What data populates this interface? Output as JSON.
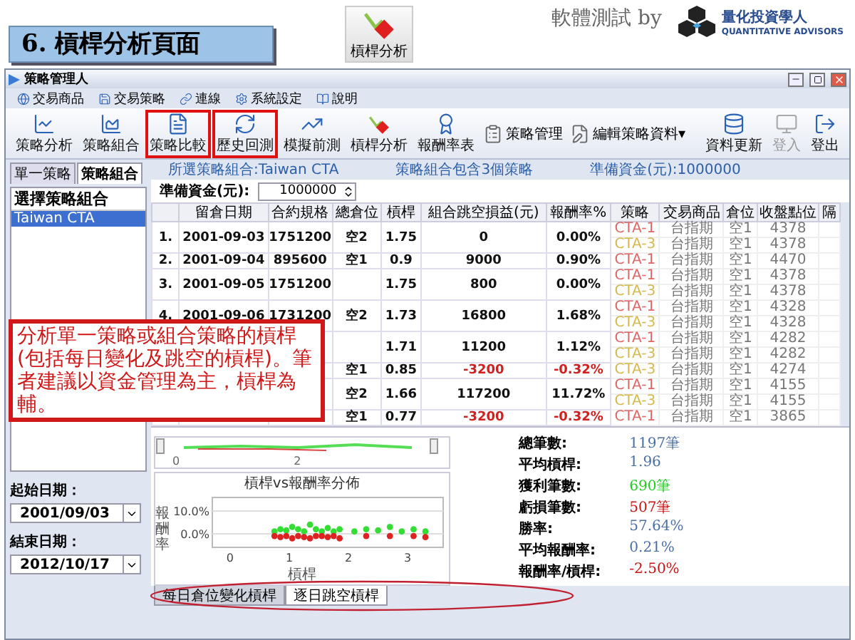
{
  "slide": {
    "title": "6. 槓桿分析頁面",
    "feature_label": "槓桿分析",
    "credit": "軟體測試 by",
    "logo_name": "量化投資學人",
    "logo_tagline": "QUANTITATIVE ADVISORS"
  },
  "window": {
    "title": "策略管理人"
  },
  "menu": [
    {
      "label": "交易商品"
    },
    {
      "label": "交易策略"
    },
    {
      "label": "連線"
    },
    {
      "label": "系統設定"
    },
    {
      "label": "說明"
    }
  ],
  "toolbar": [
    {
      "label": "策略分析",
      "highlighted": false
    },
    {
      "label": "策略組合",
      "highlighted": false
    },
    {
      "label": "策略比較",
      "highlighted": true
    },
    {
      "label": "歷史回測",
      "highlighted": true
    },
    {
      "label": "模擬前測",
      "highlighted": false
    },
    {
      "label": "槓桿分析",
      "highlighted": false
    },
    {
      "label": "報酬率表",
      "highlighted": false
    }
  ],
  "toolbar_links": [
    {
      "label": "策略管理"
    },
    {
      "label": "編輯策略資料▾"
    }
  ],
  "toolbar_right": [
    {
      "label": "資料更新",
      "disabled": false
    },
    {
      "label": "登入",
      "disabled": true
    },
    {
      "label": "登出",
      "disabled": false
    }
  ],
  "left_tabs": [
    {
      "label": "單一策略",
      "selected": false
    },
    {
      "label": "策略組合",
      "selected": true
    }
  ],
  "portfolio_heading": "選擇策略組合",
  "portfolios": [
    {
      "label": "Taiwan CTA",
      "selected": true
    }
  ],
  "start_date": {
    "label": "起始日期：",
    "value": "2001/09/03"
  },
  "end_date": {
    "label": "結束日期：",
    "value": "2012/10/17"
  },
  "info": [
    "所選策略組合:Taiwan CTA",
    "策略組合包含3個策略",
    "準備資金(元):1000000"
  ],
  "capital": {
    "label": "準備資金(元):",
    "value": "1000000"
  },
  "table": {
    "columns": [
      "留倉日期",
      "合約規格",
      "總倉位",
      "槓桿",
      "組合跳空損益(元)",
      "報酬率%",
      "策略",
      "交易商品",
      "倉位",
      "收盤點位",
      "隔"
    ],
    "rows": [
      {
        "index": "1.",
        "date": "2001-09-03",
        "contract": "1751200",
        "position": "空2",
        "leverage": "1.75",
        "pnl": "0",
        "return": "0.00%",
        "loss": false,
        "legs": [
          {
            "strategy": "CTA-1",
            "color": "#e06666",
            "product": "台指期",
            "position": "空1",
            "close": "4378"
          },
          {
            "strategy": "CTA-3",
            "color": "#d6b84c",
            "product": "台指期",
            "position": "空1",
            "close": "4378"
          }
        ]
      },
      {
        "index": "2.",
        "date": "2001-09-04",
        "contract": "895600",
        "position": "空1",
        "leverage": "0.9",
        "pnl": "9000",
        "return": "0.90%",
        "loss": false,
        "legs": [
          {
            "strategy": "CTA-1",
            "color": "#e06666",
            "product": "台指期",
            "position": "空1",
            "close": "4470"
          }
        ]
      },
      {
        "index": "3.",
        "date": "2001-09-05",
        "contract": "1751200",
        "leverage": "1.75",
        "pnl": "800",
        "return": "0.00%",
        "loss": false,
        "legs": [
          {
            "strategy": "CTA-1",
            "color": "#e06666",
            "product": "台指期",
            "position": "空1",
            "close": "4378"
          },
          {
            "strategy": "CTA-3",
            "color": "#d6b84c",
            "product": "台指期",
            "position": "空1",
            "close": "4378"
          }
        ]
      },
      {
        "index": "4.",
        "date": "2001-09-06",
        "contract": "1731200",
        "position": "空2",
        "leverage": "1.73",
        "pnl": "16800",
        "return": "1.68%",
        "loss": false,
        "legs": [
          {
            "strategy": "CTA-1",
            "color": "#e06666",
            "product": "台指期",
            "position": "空1",
            "close": "4328"
          },
          {
            "strategy": "CTA-3",
            "color": "#d6b84c",
            "product": "台指期",
            "position": "空1",
            "close": "4328"
          }
        ]
      },
      {
        "leverage": "1.71",
        "pnl": "11200",
        "return": "1.12%",
        "loss": false,
        "legs": [
          {
            "strategy": "CTA-1",
            "color": "#e06666",
            "product": "台指期",
            "position": "空1",
            "close": "4282"
          },
          {
            "strategy": "CTA-3",
            "color": "#d6b84c",
            "product": "台指期",
            "position": "空1",
            "close": "4282"
          }
        ]
      },
      {
        "position": "空1",
        "leverage": "0.85",
        "pnl": "-3200",
        "return": "-0.32%",
        "loss": true,
        "legs": [
          {
            "strategy": "CTA-3",
            "color": "#d6b84c",
            "product": "台指期",
            "position": "空1",
            "close": "4274"
          }
        ]
      },
      {
        "position": "空2",
        "leverage": "1.66",
        "pnl": "117200",
        "return": "11.72%",
        "loss": false,
        "legs": [
          {
            "strategy": "CTA-1",
            "color": "#e06666",
            "product": "台指期",
            "position": "空1",
            "close": "4155"
          },
          {
            "strategy": "CTA-3",
            "color": "#d6b84c",
            "product": "台指期",
            "position": "空1",
            "close": "4155"
          }
        ]
      },
      {
        "position": "空1",
        "leverage": "0.77",
        "pnl": "-3200",
        "return": "-0.32%",
        "loss": true,
        "legs": [
          {
            "strategy": "CTA-1",
            "color": "#e06666",
            "product": "台指期",
            "position": "空1",
            "close": "3865"
          }
        ]
      }
    ]
  },
  "callout": "分析單一策略或組合策略的槓桿(包括每日變化及跳空的槓桿)。筆者建議以資金管理為主，槓桿為輔。",
  "navigator_ticks": [
    "0",
    "2"
  ],
  "chart_data": {
    "type": "scatter",
    "title": "槓桿vs報酬率分佈",
    "xlabel": "槓桿",
    "ylabel": "報酬率",
    "x": [
      0.75,
      0.85,
      0.95,
      1.05,
      1.15,
      1.25,
      1.35,
      1.45,
      1.55,
      1.65,
      1.75,
      1.85,
      2.1,
      2.3,
      2.5,
      2.7,
      2.9,
      3.1,
      3.3
    ],
    "xlim": [
      -0.3,
      3.6
    ],
    "ylim": [
      -6,
      16
    ],
    "xticks": [
      0,
      1,
      2,
      3
    ],
    "yticks": [
      {
        "value": 0,
        "label": "0.0%"
      },
      {
        "value": 10,
        "label": "10.0%"
      }
    ],
    "series": [
      {
        "color": "#33dd33",
        "values": [
          1,
          2,
          1.5,
          3,
          2,
          1,
          4,
          2,
          1,
          2.5,
          1,
          2,
          1,
          2,
          1.5,
          3,
          1,
          2,
          1
        ]
      },
      {
        "color": "#dd2222",
        "values": [
          -1,
          -1.5,
          -1,
          -2,
          -1,
          -1.5,
          -2,
          -1,
          -1,
          -1.5,
          -1,
          -2,
          null,
          -1,
          null,
          -1,
          null,
          -1,
          -1.5
        ]
      }
    ]
  },
  "stats": [
    {
      "label": "總筆數:",
      "value": "1197筆",
      "color": "#4a6fa5"
    },
    {
      "label": "平均槓桿:",
      "value": "1.96",
      "color": "#4a6fa5"
    },
    {
      "label": "獲利筆數:",
      "value": "690筆",
      "color": "#22cc22"
    },
    {
      "label": "虧損筆數:",
      "value": "507筆",
      "color": "#cc1111"
    },
    {
      "label": "勝率:",
      "value": "57.64%",
      "color": "#4a6fa5"
    },
    {
      "label": "平均報酬率:",
      "value": "0.21%",
      "color": "#4a6fa5"
    },
    {
      "label": "報酬率/槓桿:",
      "value": "-2.50%",
      "color": "#cc1111"
    }
  ],
  "bottom_tabs": [
    {
      "label": "每日倉位變化槓桿",
      "selected": false
    },
    {
      "label": "逐日跳空槓桿",
      "selected": true
    }
  ]
}
